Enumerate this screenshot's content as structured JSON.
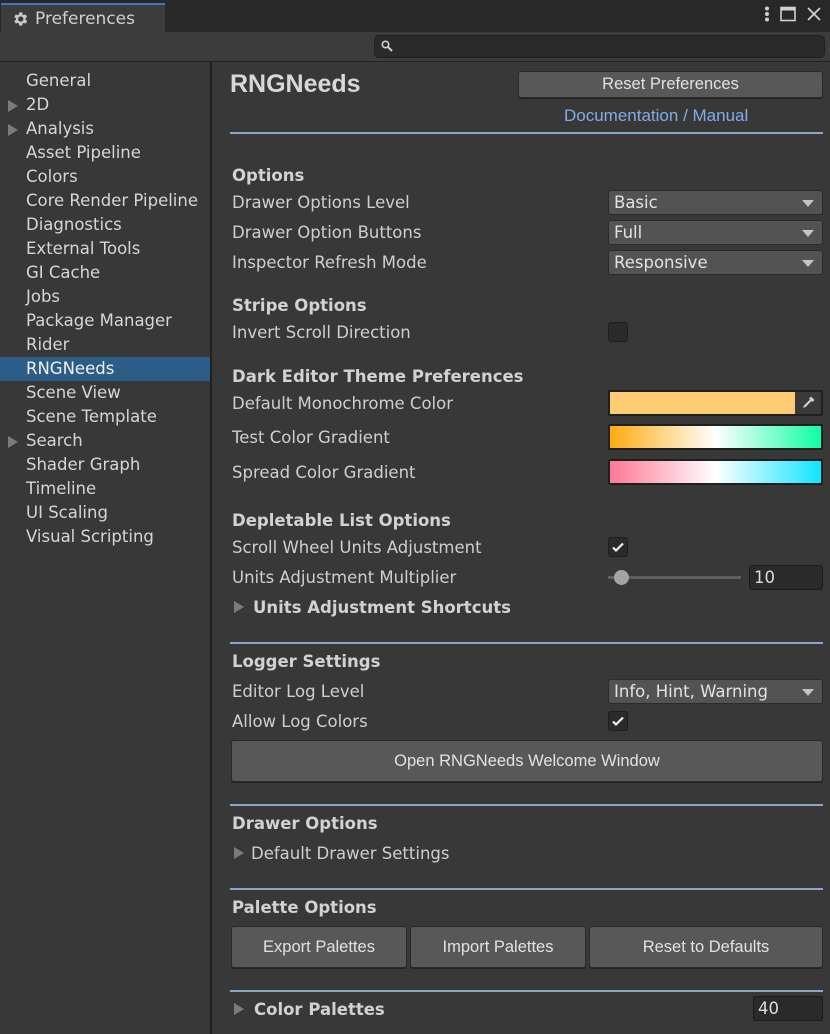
{
  "window": {
    "tab_title": "Preferences",
    "tab_icon": "gear-icon",
    "controls": [
      "more-options-icon",
      "maximize-icon",
      "close-icon"
    ]
  },
  "search": {
    "placeholder": "",
    "value": "",
    "icon": "search-icon"
  },
  "sidebar": {
    "items": [
      {
        "label": "General",
        "expandable": false,
        "selected": false
      },
      {
        "label": "2D",
        "expandable": true,
        "selected": false
      },
      {
        "label": "Analysis",
        "expandable": true,
        "selected": false
      },
      {
        "label": "Asset Pipeline",
        "expandable": false,
        "selected": false
      },
      {
        "label": "Colors",
        "expandable": false,
        "selected": false
      },
      {
        "label": "Core Render Pipeline",
        "expandable": false,
        "selected": false
      },
      {
        "label": "Diagnostics",
        "expandable": false,
        "selected": false
      },
      {
        "label": "External Tools",
        "expandable": false,
        "selected": false
      },
      {
        "label": "GI Cache",
        "expandable": false,
        "selected": false
      },
      {
        "label": "Jobs",
        "expandable": false,
        "selected": false
      },
      {
        "label": "Package Manager",
        "expandable": false,
        "selected": false
      },
      {
        "label": "Rider",
        "expandable": false,
        "selected": false
      },
      {
        "label": "RNGNeeds",
        "expandable": false,
        "selected": true
      },
      {
        "label": "Scene View",
        "expandable": false,
        "selected": false
      },
      {
        "label": "Scene Template",
        "expandable": false,
        "selected": false
      },
      {
        "label": "Search",
        "expandable": true,
        "selected": false
      },
      {
        "label": "Shader Graph",
        "expandable": false,
        "selected": false
      },
      {
        "label": "Timeline",
        "expandable": false,
        "selected": false
      },
      {
        "label": "UI Scaling",
        "expandable": false,
        "selected": false
      },
      {
        "label": "Visual Scripting",
        "expandable": false,
        "selected": false
      }
    ]
  },
  "main": {
    "title": "RNGNeeds",
    "reset_button": "Reset Preferences",
    "doc_link": "Documentation / Manual",
    "options": {
      "heading": "Options",
      "drawer_options_level": {
        "label": "Drawer Options Level",
        "value": "Basic"
      },
      "drawer_option_buttons": {
        "label": "Drawer Option Buttons",
        "value": "Full"
      },
      "inspector_refresh_mode": {
        "label": "Inspector Refresh Mode",
        "value": "Responsive"
      }
    },
    "stripe": {
      "heading": "Stripe Options",
      "invert_scroll": {
        "label": "Invert Scroll Direction",
        "checked": false
      }
    },
    "dark_theme": {
      "heading": "Dark Editor Theme Preferences",
      "monochrome": {
        "label": "Default Monochrome Color",
        "color": "#ffcc73"
      },
      "test_gradient": {
        "label": "Test Color Gradient",
        "stops": [
          "#ffab0f",
          "#ffffff",
          "#0fffa5"
        ]
      },
      "spread_gradient": {
        "label": "Spread Color Gradient",
        "stops": [
          "#ff7896",
          "#ffffff",
          "#0fe6ff"
        ]
      }
    },
    "depletable": {
      "heading": "Depletable List Options",
      "scroll_wheel": {
        "label": "Scroll Wheel Units Adjustment",
        "checked": true
      },
      "multiplier": {
        "label": "Units Adjustment Multiplier",
        "value": "10",
        "slider_fraction": 0.1
      },
      "shortcuts": {
        "label": "Units Adjustment Shortcuts",
        "expanded": false
      }
    },
    "logger": {
      "heading": "Logger Settings",
      "log_level": {
        "label": "Editor Log Level",
        "value": "Info, Hint, Warning"
      },
      "log_colors": {
        "label": "Allow Log Colors",
        "checked": true
      },
      "welcome_button": "Open RNGNeeds Welcome Window"
    },
    "drawer": {
      "heading": "Drawer Options",
      "default_settings": {
        "label": "Default Drawer Settings",
        "expanded": false
      }
    },
    "palette": {
      "heading": "Palette Options",
      "export": "Export Palettes",
      "import": "Import Palettes",
      "reset": "Reset to Defaults",
      "color_palettes": {
        "label": "Color Palettes",
        "count": "40",
        "expanded": false
      }
    }
  },
  "colors": {
    "accent": "#2c5d87",
    "link": "#7faee8",
    "divider": "#8aa6c6",
    "tab_highlight": "#3a79bb"
  }
}
